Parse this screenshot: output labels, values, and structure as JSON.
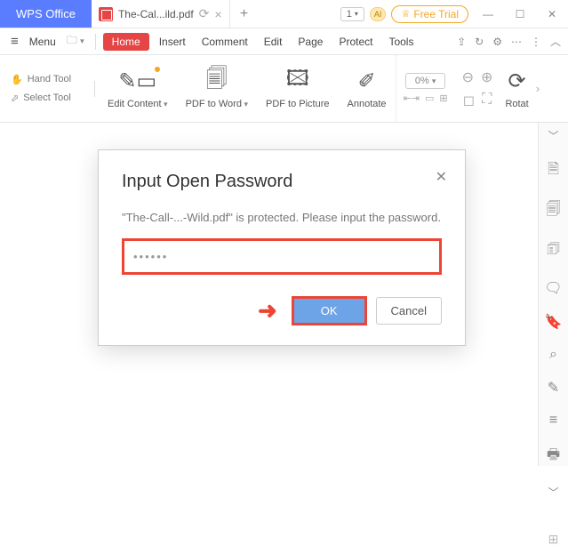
{
  "title": {
    "brand": "WPS Office",
    "tab": "The-Cal...ild.pdf",
    "badge_count": "1",
    "ai": "AI",
    "free_trial": "Free Trial"
  },
  "menubar": {
    "menu": "Menu",
    "home": "Home",
    "items": [
      "Insert",
      "Comment",
      "Edit",
      "Page",
      "Protect",
      "Tools"
    ]
  },
  "lefttools": {
    "hand": "Hand Tool",
    "select": "Select Tool"
  },
  "toolbar": {
    "edit_content": "Edit Content",
    "pdf_to_word": "PDF to Word",
    "pdf_to_picture": "PDF to Picture",
    "annotate": "Annotate",
    "zoom": "0%",
    "rotate": "Rotat"
  },
  "dialog": {
    "title": "Input Open Password",
    "message": "\"The-Call-...-Wild.pdf\" is protected. Please input the password.",
    "value": "••••••",
    "ok": "OK",
    "cancel": "Cancel"
  }
}
